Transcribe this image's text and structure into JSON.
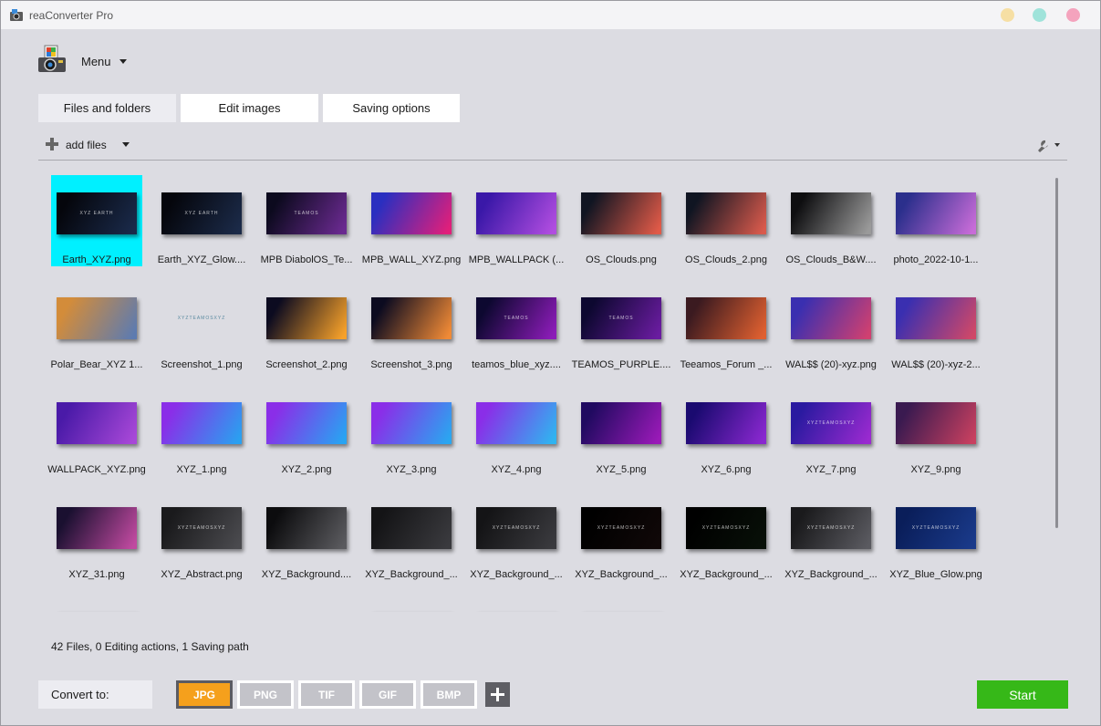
{
  "window": {
    "title": "reaConverter Pro",
    "icon": "app-icon"
  },
  "menu": {
    "label": "Menu"
  },
  "tabs": [
    {
      "label": "Files and folders"
    },
    {
      "label": "Edit images"
    },
    {
      "label": "Saving options"
    }
  ],
  "toolbar": {
    "add_files_label": "add files"
  },
  "files": [
    {
      "name": "Earth_XYZ.png",
      "c1": "#05060c",
      "c2": "#1a2a4a",
      "text": "XYZ EARTH",
      "selected": true
    },
    {
      "name": "Earth_XYZ_Glow....",
      "c1": "#05060c",
      "c2": "#1b2a48",
      "text": "XYZ EARTH"
    },
    {
      "name": "MPB DiabolOS_Te...",
      "c1": "#0c0a1e",
      "c2": "#6a2a90",
      "text": "TEAMOS"
    },
    {
      "name": "MPB_WALL_XYZ.png",
      "c1": "#2a2fc0",
      "c2": "#e21f7a",
      "text": ""
    },
    {
      "name": "MPB_WALLPACK (...",
      "c1": "#3a18a8",
      "c2": "#b14de0",
      "text": ""
    },
    {
      "name": "OS_Clouds.png",
      "c1": "#101522",
      "c2": "#e05a48",
      "text": ""
    },
    {
      "name": "OS_Clouds_2.png",
      "c1": "#101522",
      "c2": "#d95a4c",
      "text": ""
    },
    {
      "name": "OS_Clouds_B&W....",
      "c1": "#0e0e10",
      "c2": "#9a9a9a",
      "text": ""
    },
    {
      "name": "photo_2022-10-1...",
      "c1": "#2b2f8c",
      "c2": "#c86cd8",
      "text": ""
    },
    {
      "name": "Polar_Bear_XYZ 1...",
      "c1": "#d38c3a",
      "c2": "#5d7bb0",
      "text": ""
    },
    {
      "name": "Screenshot_1.png",
      "c1": "#dcdce2",
      "c2": "#dcdce2",
      "text": "XYZTEAMOSXYZ",
      "plain": true
    },
    {
      "name": "Screenshot_2.png",
      "c1": "#0c0b20",
      "c2": "#f6a12a",
      "text": ""
    },
    {
      "name": "Screenshot_3.png",
      "c1": "#0c0b20",
      "c2": "#f08a36",
      "text": ""
    },
    {
      "name": "teamos_blue_xyz....",
      "c1": "#0d0830",
      "c2": "#8c1cb8",
      "text": "TEAMOS"
    },
    {
      "name": "TEAMOS_PURPLE....",
      "c1": "#0d0830",
      "c2": "#6a1ca0",
      "text": "TEAMOS"
    },
    {
      "name": "Teeamos_Forum _...",
      "c1": "#3b1a20",
      "c2": "#e06030",
      "text": ""
    },
    {
      "name": "WAL$$ (20)-xyz.png",
      "c1": "#3a2fb0",
      "c2": "#d04070",
      "text": ""
    },
    {
      "name": "WAL$$ (20)-xyz-2...",
      "c1": "#3a2fb0",
      "c2": "#d04868",
      "text": ""
    },
    {
      "name": "WALLPACK_XYZ.png",
      "c1": "#4a1aa8",
      "c2": "#a848d8",
      "text": ""
    },
    {
      "name": "XYZ_1.png",
      "c1": "#8a2ee8",
      "c2": "#2aa0f0",
      "text": ""
    },
    {
      "name": "XYZ_2.png",
      "c1": "#8a2ee8",
      "c2": "#28a4f2",
      "text": ""
    },
    {
      "name": "XYZ_3.png",
      "c1": "#8a2ee8",
      "c2": "#2aa6f0",
      "text": ""
    },
    {
      "name": "XYZ_4.png",
      "c1": "#8a2ee8",
      "c2": "#30b4f0",
      "text": ""
    },
    {
      "name": "XYZ_5.png",
      "c1": "#200a60",
      "c2": "#9a1ab8",
      "text": ""
    },
    {
      "name": "XYZ_6.png",
      "c1": "#1a0a70",
      "c2": "#8a28d0",
      "text": ""
    },
    {
      "name": "XYZ_7.png",
      "c1": "#2a1aa0",
      "c2": "#9a2ad0",
      "text": "XYZTEAMOSXYZ"
    },
    {
      "name": "XYZ_9.png",
      "c1": "#3a1a50",
      "c2": "#c84060",
      "text": ""
    },
    {
      "name": "XYZ_31.png",
      "c1": "#1a1030",
      "c2": "#c04aa0",
      "text": ""
    },
    {
      "name": "XYZ_Abstract.png",
      "c1": "#1a1a1c",
      "c2": "#4a4a4e",
      "text": "XYZTEAMOSXYZ"
    },
    {
      "name": "XYZ_Background....",
      "c1": "#0c0c0e",
      "c2": "#5a5a5e",
      "text": ""
    },
    {
      "name": "XYZ_Background_...",
      "c1": "#141416",
      "c2": "#3a3a3e",
      "text": ""
    },
    {
      "name": "XYZ_Background_...",
      "c1": "#141416",
      "c2": "#3a3a3e",
      "text": "XYZTEAMOSXYZ"
    },
    {
      "name": "XYZ_Background_...",
      "c1": "#000000",
      "c2": "#100808",
      "text": "XYZTEAMOSXYZ"
    },
    {
      "name": "XYZ_Background_...",
      "c1": "#000000",
      "c2": "#081008",
      "text": "XYZTEAMOSXYZ"
    },
    {
      "name": "XYZ_Background_...",
      "c1": "#1a1a1c",
      "c2": "#5a5a60",
      "text": "XYZTEAMOSXYZ"
    },
    {
      "name": "XYZ_Blue_Glow.png",
      "c1": "#0a1e5a",
      "c2": "#1a3a8a",
      "text": "XYZTEAMOSXYZ"
    },
    {
      "name": "",
      "c1": "#1a2a6a",
      "c2": "#2a4a9a",
      "text": ""
    },
    {
      "name": "",
      "c1": "#dcdce2",
      "c2": "#dcdce2",
      "text": "",
      "plain": true
    },
    {
      "name": "",
      "c1": "#dcdce2",
      "c2": "#dcdce2",
      "text": "",
      "plain": true
    },
    {
      "name": "",
      "c1": "#050505",
      "c2": "#202024",
      "text": ""
    },
    {
      "name": "",
      "c1": "#3a3a40",
      "c2": "#5a5a60",
      "text": ""
    },
    {
      "name": "",
      "c1": "#3a3a40",
      "c2": "#5a5a60",
      "text": ""
    }
  ],
  "status": {
    "files": "42 Files,",
    "editing": "0 Editing actions,",
    "saving": "1 Saving path"
  },
  "convert": {
    "label": "Convert to:",
    "formats": [
      "JPG",
      "PNG",
      "TIF",
      "GIF",
      "BMP"
    ],
    "active_format": "JPG"
  },
  "start_label": "Start",
  "colors": {
    "selected_tile": "#00f0ff",
    "active_format": "#f5a01c",
    "start_button": "#36b818"
  }
}
